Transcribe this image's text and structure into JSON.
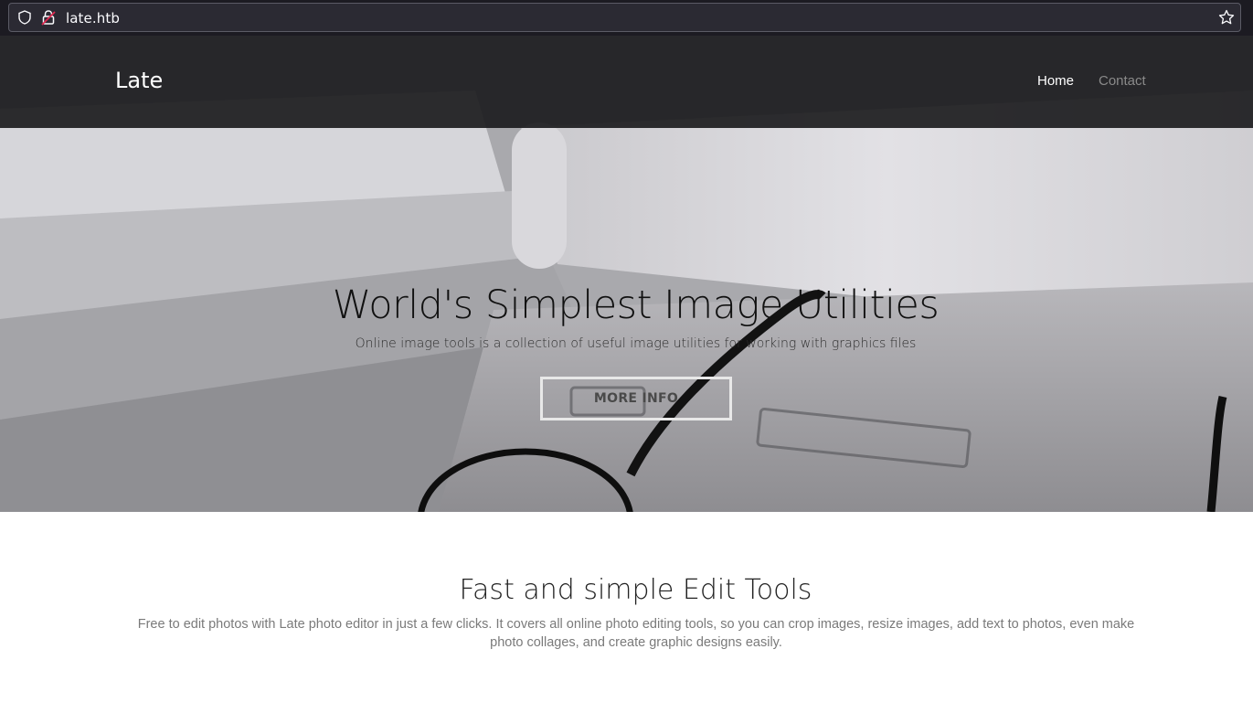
{
  "browser": {
    "url": "late.htb",
    "icons": [
      "shield-icon",
      "lock-icon",
      "star-icon"
    ]
  },
  "nav": {
    "brand": "Late",
    "items": [
      {
        "label": "Home",
        "active": true
      },
      {
        "label": "Contact",
        "active": false
      }
    ]
  },
  "hero": {
    "title": "World's Simplest Image Utilities",
    "subtitle": "Online image tools is a collection of useful image utilities for working with graphics files",
    "button_label": "MORE INFO"
  },
  "section": {
    "title": "Fast and simple Edit Tools",
    "text": "Free to edit photos with Late photo editor in just a few clicks. It covers all online photo editing tools, so you can crop images, resize images, add text to photos, even make photo collages, and create graphic designs easily."
  },
  "colors": {
    "navbar_bg": "#1c1c1e",
    "brand": "#ffffff",
    "nav_active": "#ffffff",
    "nav_inactive": "#8a8a8a",
    "hero_title": "#111111",
    "section_text": "#7a7a7a"
  }
}
